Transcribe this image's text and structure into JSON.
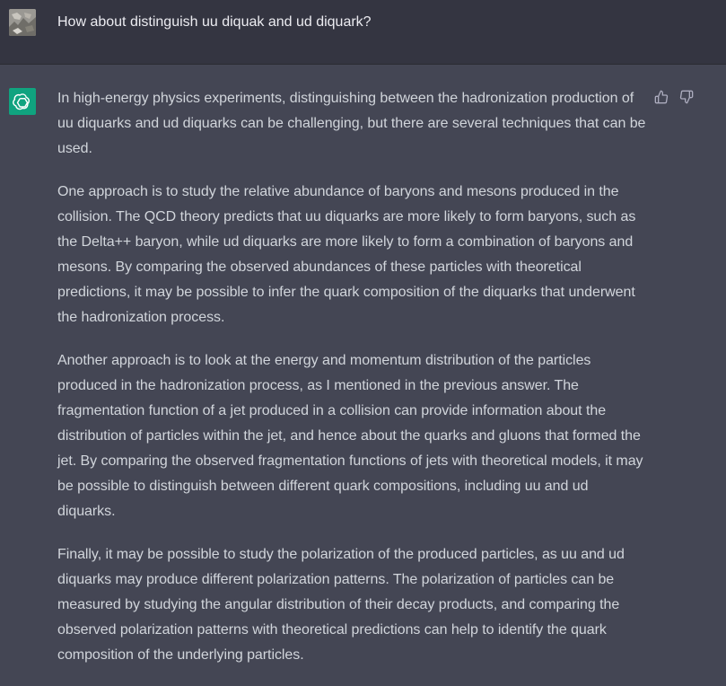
{
  "user_message": {
    "avatar_icon": "user-photo-icon",
    "text": "How about distinguish uu diquak and ud diquark?"
  },
  "assistant_message": {
    "avatar_icon": "openai-logo-icon",
    "accent_color": "#10a37f",
    "paragraphs": [
      "In high-energy physics experiments, distinguishing between the hadronization production of uu diquarks and ud diquarks can be challenging, but there are several techniques that can be used.",
      "One approach is to study the relative abundance of baryons and mesons produced in the collision. The QCD theory predicts that uu diquarks are more likely to form baryons, such as the Delta++ baryon, while ud diquarks are more likely to form a combination of baryons and mesons. By comparing the observed abundances of these particles with theoretical predictions, it may be possible to infer the quark composition of the diquarks that underwent the hadronization process.",
      "Another approach is to look at the energy and momentum distribution of the particles produced in the hadronization process, as I mentioned in the previous answer. The fragmentation function of a jet produced in a collision can provide information about the distribution of particles within the jet, and hence about the quarks and gluons that formed the jet. By comparing the observed fragmentation functions of jets with theoretical models, it may be possible to distinguish between different quark compositions, including uu and ud diquarks.",
      "Finally, it may be possible to study the polarization of the produced particles, as uu and ud diquarks may produce different polarization patterns. The polarization of particles can be measured by studying the angular distribution of their decay products, and comparing the observed polarization patterns with theoretical predictions can help to identify the quark composition of the underlying particles."
    ],
    "feedback_icons": [
      "thumbs-up-icon",
      "thumbs-down-icon"
    ]
  }
}
